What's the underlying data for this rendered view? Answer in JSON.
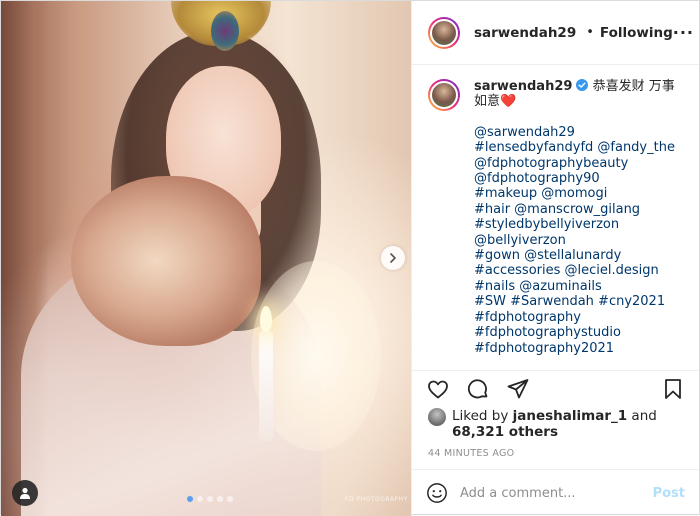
{
  "header": {
    "username": "sarwendah29",
    "separator": "•",
    "follow_label": "Following",
    "more_label": "···"
  },
  "caption": {
    "username": "sarwendah29",
    "text": "恭喜发财 万事如意",
    "emoji": "❤️",
    "lines": [
      "@sarwendah29",
      "#lensedbyfandyfd @fandy_the",
      "@fdphotographybeauty",
      "@fdphotography90",
      "#makeup @momogi",
      "#hair @manscrow_gilang",
      "#styledbybellyiverzon",
      "@bellyiverzon",
      "#gown @stellalunardy",
      "#accessories @leciel.design",
      "#nails @azuminails",
      "#SW #Sarwendah #cny2021",
      "#fdphotography",
      "#fdphotographystudio",
      "#fdphotography2021"
    ]
  },
  "likes": {
    "prefix": "Liked by ",
    "user": "janeshalimar_1",
    "middle": " and",
    "count": "68,321 others"
  },
  "time": "44 MINUTES AGO",
  "comment": {
    "placeholder": "Add a comment...",
    "post_label": "Post"
  },
  "media": {
    "watermark": "FD PHOTOGRAPHY",
    "carousel_count": 5,
    "carousel_active": 0
  },
  "colors": {
    "link": "#00376b",
    "verified": "#3897f0",
    "post_disabled": "#b2dffc",
    "carousel_active": "#5aa0f0"
  },
  "icons": [
    "verified-icon",
    "more-icon",
    "heart-icon",
    "comment-icon",
    "share-icon",
    "bookmark-icon",
    "emoji-icon",
    "chevron-right-icon",
    "user-tag-icon"
  ]
}
